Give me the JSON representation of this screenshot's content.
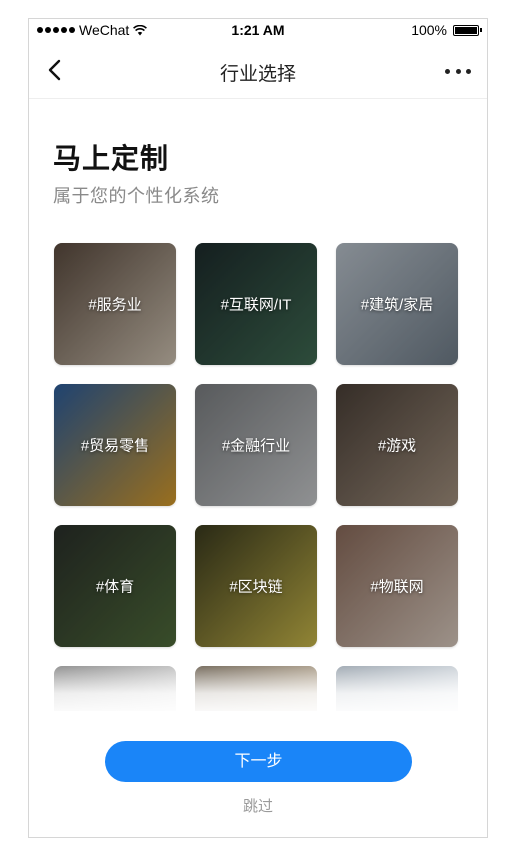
{
  "status_bar": {
    "carrier": "WeChat",
    "time": "1:21 AM",
    "battery": "100%"
  },
  "nav": {
    "title": "行业选择",
    "back_icon": "chevron-left-icon",
    "more_icon": "more-dots-icon"
  },
  "header": {
    "title": "马上定制",
    "subtitle": "属于您的个性化系统"
  },
  "industries": [
    {
      "label": "#服务业",
      "colors": [
        "#5a4a3e",
        "#cfc3b2"
      ]
    },
    {
      "label": "#互联网/IT",
      "colors": [
        "#1d2b2c",
        "#3f6a52"
      ]
    },
    {
      "label": "#建筑/家居",
      "colors": [
        "#b9c2cb",
        "#6f7c88"
      ]
    },
    {
      "label": "#贸易零售",
      "colors": [
        "#2b5d9c",
        "#d59a2a"
      ]
    },
    {
      "label": "#金融行业",
      "colors": [
        "#7a7d80",
        "#c7c9cb"
      ]
    },
    {
      "label": "#游戏",
      "colors": [
        "#4a3f37",
        "#a2907e"
      ]
    },
    {
      "label": "#体育",
      "colors": [
        "#2a2f2a",
        "#4f6b3a"
      ]
    },
    {
      "label": "#区块链",
      "colors": [
        "#3a3a1e",
        "#c9b84a"
      ]
    },
    {
      "label": "#物联网",
      "colors": [
        "#8a6a5a",
        "#d9cabe"
      ]
    }
  ],
  "faded_row_colors": [
    [
      "#7b7b7b",
      "#cfcfcf"
    ],
    [
      "#5c5040",
      "#b8a890"
    ],
    [
      "#8f9aa5",
      "#d7dde3"
    ]
  ],
  "actions": {
    "next_label": "下一步",
    "skip_label": "跳过"
  },
  "colors": {
    "primary": "#1a85f8",
    "subtitle": "#8a8a8a",
    "skip": "#9a9a9a"
  }
}
